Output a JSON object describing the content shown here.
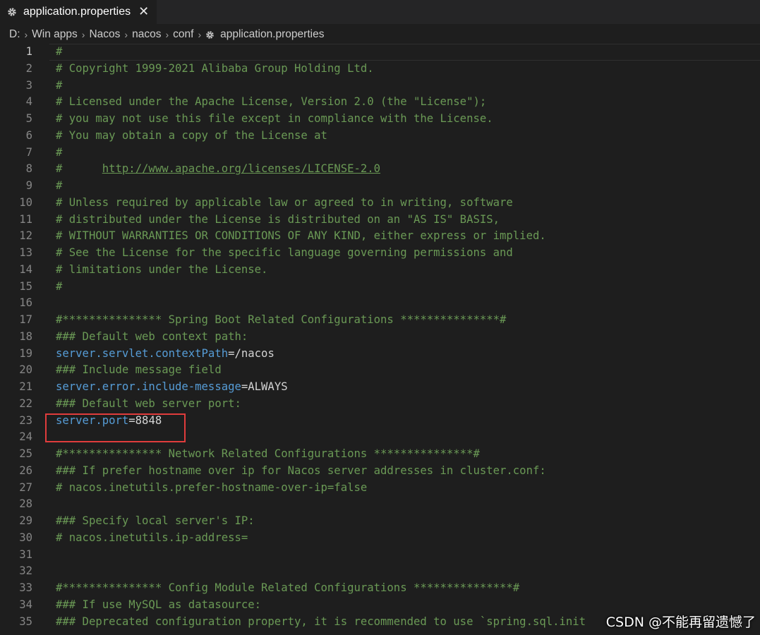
{
  "tab": {
    "icon": "gear-icon",
    "label": "application.properties",
    "close_symbol": "✕"
  },
  "breadcrumb": {
    "items": [
      "D:",
      "Win apps",
      "Nacos",
      "nacos",
      "conf"
    ],
    "file": "application.properties",
    "file_icon": "gear-icon"
  },
  "editor": {
    "current_line": 1,
    "lines": [
      {
        "n": "1",
        "type": "comment",
        "text": "#"
      },
      {
        "n": "2",
        "type": "comment",
        "text": "# Copyright 1999-2021 Alibaba Group Holding Ltd."
      },
      {
        "n": "3",
        "type": "comment",
        "text": "#"
      },
      {
        "n": "4",
        "type": "comment",
        "text": "# Licensed under the Apache License, Version 2.0 (the \"License\");"
      },
      {
        "n": "5",
        "type": "comment",
        "text": "# you may not use this file except in compliance with the License."
      },
      {
        "n": "6",
        "type": "comment",
        "text": "# You may obtain a copy of the License at"
      },
      {
        "n": "7",
        "type": "comment",
        "text": "#"
      },
      {
        "n": "8",
        "type": "url",
        "prefix": "#      ",
        "text": "http://www.apache.org/licenses/LICENSE-2.0"
      },
      {
        "n": "9",
        "type": "comment",
        "text": "#"
      },
      {
        "n": "10",
        "type": "comment",
        "text": "# Unless required by applicable law or agreed to in writing, software"
      },
      {
        "n": "11",
        "type": "comment",
        "text": "# distributed under the License is distributed on an \"AS IS\" BASIS,"
      },
      {
        "n": "12",
        "type": "comment",
        "text": "# WITHOUT WARRANTIES OR CONDITIONS OF ANY KIND, either express or implied."
      },
      {
        "n": "13",
        "type": "comment",
        "text": "# See the License for the specific language governing permissions and"
      },
      {
        "n": "14",
        "type": "comment",
        "text": "# limitations under the License."
      },
      {
        "n": "15",
        "type": "comment",
        "text": "#"
      },
      {
        "n": "16",
        "type": "empty",
        "text": ""
      },
      {
        "n": "17",
        "type": "comment",
        "text": "#*************** Spring Boot Related Configurations ***************#"
      },
      {
        "n": "18",
        "type": "comment",
        "text": "### Default web context path:"
      },
      {
        "n": "19",
        "type": "property",
        "key": "server.servlet.contextPath",
        "value": "/nacos"
      },
      {
        "n": "20",
        "type": "comment",
        "text": "### Include message field"
      },
      {
        "n": "21",
        "type": "property",
        "key": "server.error.include-message",
        "value": "ALWAYS"
      },
      {
        "n": "22",
        "type": "comment",
        "text": "### Default web server port:"
      },
      {
        "n": "23",
        "type": "property",
        "key": "server.port",
        "value": "8848"
      },
      {
        "n": "24",
        "type": "empty",
        "text": ""
      },
      {
        "n": "25",
        "type": "comment",
        "text": "#*************** Network Related Configurations ***************#"
      },
      {
        "n": "26",
        "type": "comment",
        "text": "### If prefer hostname over ip for Nacos server addresses in cluster.conf:"
      },
      {
        "n": "27",
        "type": "comment",
        "text": "# nacos.inetutils.prefer-hostname-over-ip=false"
      },
      {
        "n": "28",
        "type": "empty",
        "text": ""
      },
      {
        "n": "29",
        "type": "comment",
        "text": "### Specify local server's IP:"
      },
      {
        "n": "30",
        "type": "comment",
        "text": "# nacos.inetutils.ip-address="
      },
      {
        "n": "31",
        "type": "empty",
        "text": ""
      },
      {
        "n": "32",
        "type": "empty",
        "text": ""
      },
      {
        "n": "33",
        "type": "comment",
        "text": "#*************** Config Module Related Configurations ***************#"
      },
      {
        "n": "34",
        "type": "comment",
        "text": "### If use MySQL as datasource:"
      },
      {
        "n": "35",
        "type": "comment",
        "text": "### Deprecated configuration property, it is recommended to use `spring.sql.init"
      }
    ]
  },
  "watermark": "CSDN @不能再留遗憾了",
  "colors": {
    "background": "#1e1e1e",
    "comment": "#6a9955",
    "key": "#569cd6",
    "value": "#d4d4d4",
    "line_number": "#858585",
    "highlight_box": "#e03c3c"
  }
}
